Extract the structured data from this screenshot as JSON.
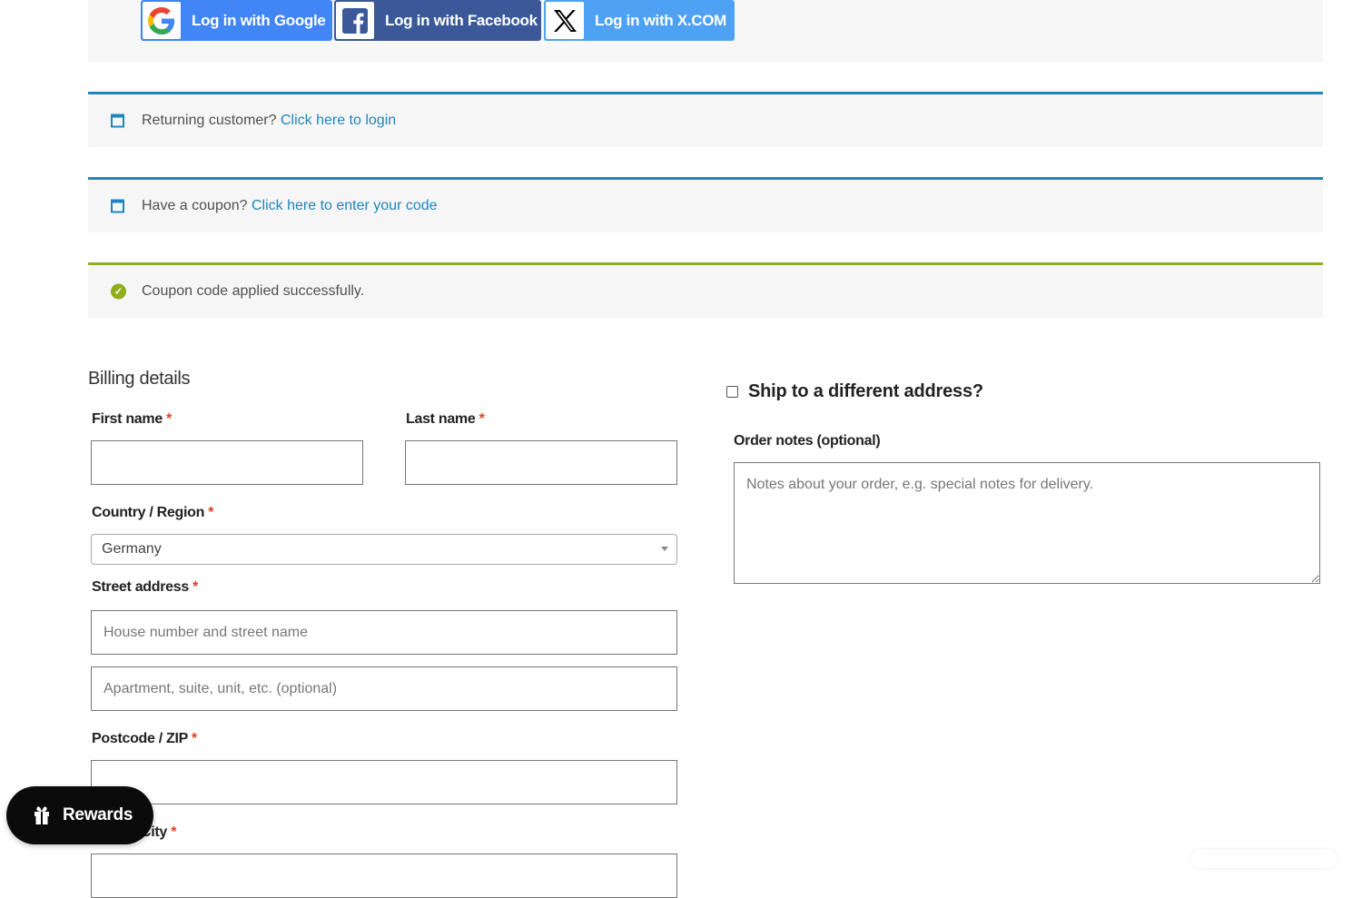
{
  "social_login": {
    "google_label": "Log in with Google",
    "facebook_label": "Log in with Facebook",
    "x_label": "Log in with X.COM"
  },
  "notices": {
    "returning": {
      "text": "Returning customer?",
      "link": "Click here to login"
    },
    "coupon": {
      "text": "Have a coupon?",
      "link": "Click here to enter your code"
    },
    "success": {
      "text": "Coupon code applied successfully."
    }
  },
  "billing": {
    "title": "Billing details",
    "required_mark": "*",
    "first_name": {
      "label": "First name",
      "value": ""
    },
    "last_name": {
      "label": "Last name",
      "value": ""
    },
    "country": {
      "label": "Country / Region",
      "value": "Germany"
    },
    "street": {
      "label": "Street address",
      "placeholder1": "House number and street name",
      "placeholder2": "Apartment, suite, unit, etc. (optional)"
    },
    "postcode": {
      "label": "Postcode / ZIP",
      "value": ""
    },
    "city": {
      "label": "City"
    }
  },
  "shipping": {
    "ship_different_label": "Ship to a different address?",
    "ship_different_checked": false
  },
  "order_notes": {
    "label": "Order notes (optional)",
    "placeholder": "Notes about your order, e.g. special notes for delivery."
  },
  "rewards": {
    "label": "Rewards"
  },
  "colors": {
    "google_blue": "#4285f4",
    "facebook_blue": "#3b5998",
    "x_blue": "#4ea1f3",
    "info_accent": "#1e85be",
    "success_accent": "#8fae1b",
    "required_red": "#e2401c"
  }
}
